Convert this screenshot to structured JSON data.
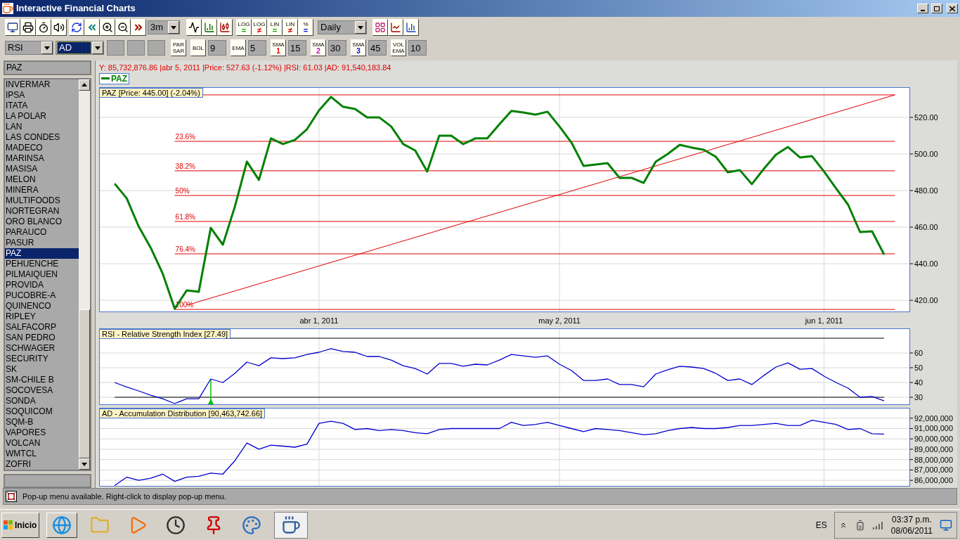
{
  "window": {
    "title": "Interactive Financial Charts"
  },
  "toolbar": {
    "period": "3m",
    "scale_buttons": [
      {
        "top": "LOG",
        "bottom": "=",
        "color": "#00a000"
      },
      {
        "top": "LOG",
        "bottom": "≠",
        "color": "#e00000"
      },
      {
        "top": "LIN",
        "bottom": "=",
        "color": "#00a000"
      },
      {
        "top": "LIN",
        "bottom": "≠",
        "color": "#e00000"
      },
      {
        "top": "%",
        "bottom": "=",
        "color": "#0000e0"
      }
    ],
    "interval": "Daily"
  },
  "indicator_bar": {
    "selects": [
      {
        "value": "RSI",
        "selected": false
      },
      {
        "value": "AD",
        "selected": true
      }
    ],
    "params": [
      {
        "label": "PAR SAR"
      },
      {
        "label": "BOL",
        "value": "9"
      },
      {
        "label": "EMA",
        "value": "5"
      },
      {
        "label": "SMA 1",
        "color": "#e00000",
        "value": "15"
      },
      {
        "label": "SMA 2",
        "color": "#c000c0",
        "value": "30"
      },
      {
        "label": "SMA 3",
        "color": "#0000e0",
        "value": "45"
      },
      {
        "label": "VOL EMA",
        "value": "10"
      }
    ]
  },
  "sidebar": {
    "search": {
      "value": "PAZ"
    },
    "items": [
      {
        "label": "INVERMAR",
        "selected": false
      },
      {
        "label": "IPSA",
        "selected": false
      },
      {
        "label": "ITATA",
        "selected": false
      },
      {
        "label": "LA POLAR",
        "selected": false
      },
      {
        "label": "LAN",
        "selected": false
      },
      {
        "label": "LAS CONDES",
        "selected": false
      },
      {
        "label": "MADECO",
        "selected": false
      },
      {
        "label": "MARINSA",
        "selected": false
      },
      {
        "label": "MASISA",
        "selected": false
      },
      {
        "label": "MELON",
        "selected": false
      },
      {
        "label": "MINERA",
        "selected": false
      },
      {
        "label": "MULTIFOODS",
        "selected": false
      },
      {
        "label": "NORTEGRAN",
        "selected": false
      },
      {
        "label": "ORO BLANCO",
        "selected": false
      },
      {
        "label": "PARAUCO",
        "selected": false
      },
      {
        "label": "PASUR",
        "selected": false
      },
      {
        "label": "PAZ",
        "selected": true
      },
      {
        "label": "PEHUENCHE",
        "selected": false
      },
      {
        "label": "PILMAIQUEN",
        "selected": false
      },
      {
        "label": "PROVIDA",
        "selected": false
      },
      {
        "label": "PUCOBRE-A",
        "selected": false
      },
      {
        "label": "QUINENCO",
        "selected": false
      },
      {
        "label": "RIPLEY",
        "selected": false
      },
      {
        "label": "SALFACORP",
        "selected": false
      },
      {
        "label": "SAN PEDRO",
        "selected": false
      },
      {
        "label": "SCHWAGER",
        "selected": false
      },
      {
        "label": "SECURITY",
        "selected": false
      },
      {
        "label": "SK",
        "selected": false
      },
      {
        "label": "SM-CHILE B",
        "selected": false
      },
      {
        "label": "SOCOVESA",
        "selected": false
      },
      {
        "label": "SONDA",
        "selected": false
      },
      {
        "label": "SOQUICOM",
        "selected": false
      },
      {
        "label": "SQM-B",
        "selected": false
      },
      {
        "label": "VAPORES",
        "selected": false
      },
      {
        "label": "VOLCAN",
        "selected": false
      },
      {
        "label": "WMTCL",
        "selected": false
      },
      {
        "label": "ZOFRI",
        "selected": false
      }
    ]
  },
  "chart": {
    "readout": "Y: 85,732,876.86 |abr 5, 2011 |Price: 527.63 (-1.12%) |RSI: 61.03 |AD: 91,540,183.84",
    "panels": [
      {
        "kind": "price",
        "title": "PAZ [Price: 445.00] (-2.04%)",
        "chart_data": {
          "type": "line",
          "grid": true,
          "categories": [
            null,
            null,
            null,
            null,
            null,
            null,
            null,
            null,
            null,
            null,
            null,
            null,
            null,
            null,
            null,
            null,
            null,
            "abr 1, 2011",
            null,
            null,
            null,
            null,
            null,
            null,
            null,
            null,
            null,
            null,
            null,
            null,
            null,
            null,
            null,
            null,
            null,
            null,
            null,
            "may 2, 2011",
            null,
            null,
            null,
            null,
            null,
            null,
            null,
            null,
            null,
            null,
            null,
            null,
            null,
            null,
            null,
            null,
            null,
            null,
            null,
            null,
            null,
            "jun 1, 2011",
            null,
            null,
            null,
            null,
            null
          ],
          "ylim": [
            413.5,
            536.5
          ],
          "yticks": [
            {
              "value": 420,
              "label": "420.00"
            },
            {
              "value": 440,
              "label": "440.00"
            },
            {
              "value": 460,
              "label": "460.00"
            },
            {
              "value": 480,
              "label": "480.00"
            },
            {
              "value": 500,
              "label": "500.00"
            },
            {
              "value": 520,
              "label": "520.00"
            }
          ],
          "series": [
            {
              "name": "PAZ",
              "color": "#008000",
              "values": [
                483.8,
                475.8,
                460.4,
                448.8,
                434.6,
                415.4,
                425.4,
                424.6,
                459.6,
                450.4,
                471.2,
                495.8,
                485.8,
                508.5,
                505.4,
                507.7,
                513.5,
                523.8,
                531.2,
                525.8,
                524.6,
                520,
                520,
                515,
                505.4,
                501.9,
                490.4,
                510,
                510,
                505.4,
                508.5,
                508.5,
                516.2,
                523.5,
                522.7,
                521.5,
                523.1,
                515,
                506.2,
                493.5,
                494.2,
                495,
                486.9,
                486.9,
                484.2,
                495.8,
                500,
                505,
                503.5,
                502.3,
                498.5,
                490,
                491.2,
                483.5,
                491.9,
                499.6,
                503.8,
                498.1,
                498.8,
                490.4,
                481.2,
                472.3,
                457.3,
                457.7,
                445
              ]
            }
          ],
          "ref_lines": [
            {
              "axis": "y",
              "value": 532.3,
              "color": "#e00000"
            },
            {
              "axis": "y",
              "value": 506.9,
              "color": "#e00000"
            },
            {
              "axis": "y",
              "value": 490.8,
              "color": "#e00000"
            },
            {
              "axis": "y",
              "value": 477.3,
              "color": "#e00000"
            },
            {
              "axis": "y",
              "value": 463.1,
              "color": "#e00000"
            },
            {
              "axis": "y",
              "value": 445.4,
              "color": "#e00000"
            },
            {
              "axis": "y",
              "value": 415,
              "color": "#e00000"
            }
          ]
        },
        "fibonacci_labels": [
          "23.6%",
          "38.2%",
          "50%",
          "61.8%",
          "76.4%",
          "100%"
        ]
      },
      {
        "kind": "rsi",
        "title": "RSI - Relative Strength Index [27.49]",
        "chart_data": {
          "type": "line",
          "grid": true,
          "ylim": [
            24.76,
            76.67
          ],
          "yticks": [
            {
              "value": 30,
              "label": "30"
            },
            {
              "value": 40,
              "label": "40"
            },
            {
              "value": 50,
              "label": "50"
            },
            {
              "value": 60,
              "label": "60"
            }
          ],
          "series": [
            {
              "color": "#0000d0",
              "values": [
                40,
                37,
                34.3,
                31.4,
                29,
                25.7,
                29,
                29,
                42.4,
                40,
                46.2,
                53.8,
                51.4,
                56.7,
                56.2,
                56.7,
                59,
                60.5,
                62.9,
                61,
                60.5,
                57.6,
                57.6,
                55.2,
                51.4,
                49.5,
                45.7,
                52.9,
                52.9,
                51,
                52.4,
                51.9,
                55.2,
                59,
                58,
                57.1,
                58,
                52.4,
                48.1,
                41.4,
                41.4,
                42.4,
                38.6,
                38.6,
                37.1,
                45.7,
                48.6,
                51,
                50.5,
                49.5,
                46.2,
                41.4,
                42.4,
                38.6,
                44.8,
                50.5,
                53.3,
                49,
                49.5,
                44.3,
                40,
                36.2,
                30,
                30.5,
                27.5
              ]
            }
          ],
          "ref_lines": [
            {
              "axis": "y",
              "value": 70,
              "color": "#000000"
            },
            {
              "axis": "y",
              "value": 30,
              "color": "#000000"
            }
          ]
        }
      },
      {
        "kind": "ad",
        "title": "AD - Accumulation Distribution [90,463,742.66]",
        "chart_data": {
          "type": "line",
          "grid": true,
          "ylim": [
            85400000,
            93000000
          ],
          "yticks": [
            {
              "value": 86000000,
              "label": "86,000,000"
            },
            {
              "value": 87000000,
              "label": "87,000,000"
            },
            {
              "value": 88000000,
              "label": "88,000,000"
            },
            {
              "value": 89000000,
              "label": "89,000,000"
            },
            {
              "value": 90000000,
              "label": "90,000,000"
            },
            {
              "value": 91000000,
              "label": "91,000,000"
            },
            {
              "value": 92000000,
              "label": "92,000,000"
            }
          ],
          "series": [
            {
              "color": "#0000d0",
              "values": [
                85500000,
                86300000,
                86000000,
                86200000,
                86600000,
                85900000,
                86300000,
                86400000,
                86700000,
                86600000,
                87900000,
                89600000,
                89000000,
                89400000,
                89300000,
                89200000,
                89500000,
                91500000,
                91700000,
                91500000,
                90900000,
                91000000,
                90800000,
                90900000,
                90800000,
                90600000,
                90500000,
                90900000,
                91000000,
                91000000,
                91000000,
                91000000,
                91000000,
                91600000,
                91300000,
                91400000,
                91600000,
                91300000,
                91000000,
                90700000,
                91000000,
                90900000,
                90800000,
                90600000,
                90400000,
                90500000,
                90800000,
                91000000,
                91100000,
                91000000,
                91000000,
                91100000,
                91300000,
                91300000,
                91400000,
                91500000,
                91300000,
                91300000,
                91800000,
                91600000,
                91400000,
                90900000,
                91000000,
                90500000,
                90460000
              ]
            }
          ]
        }
      }
    ]
  },
  "status_bar": {
    "text": "Pop-up menu available. Right-click to display pop-up menu."
  },
  "taskbar": {
    "start": "Inicio",
    "language": "ES",
    "time": "03:37 p.m.",
    "date": "08/06/2011"
  }
}
